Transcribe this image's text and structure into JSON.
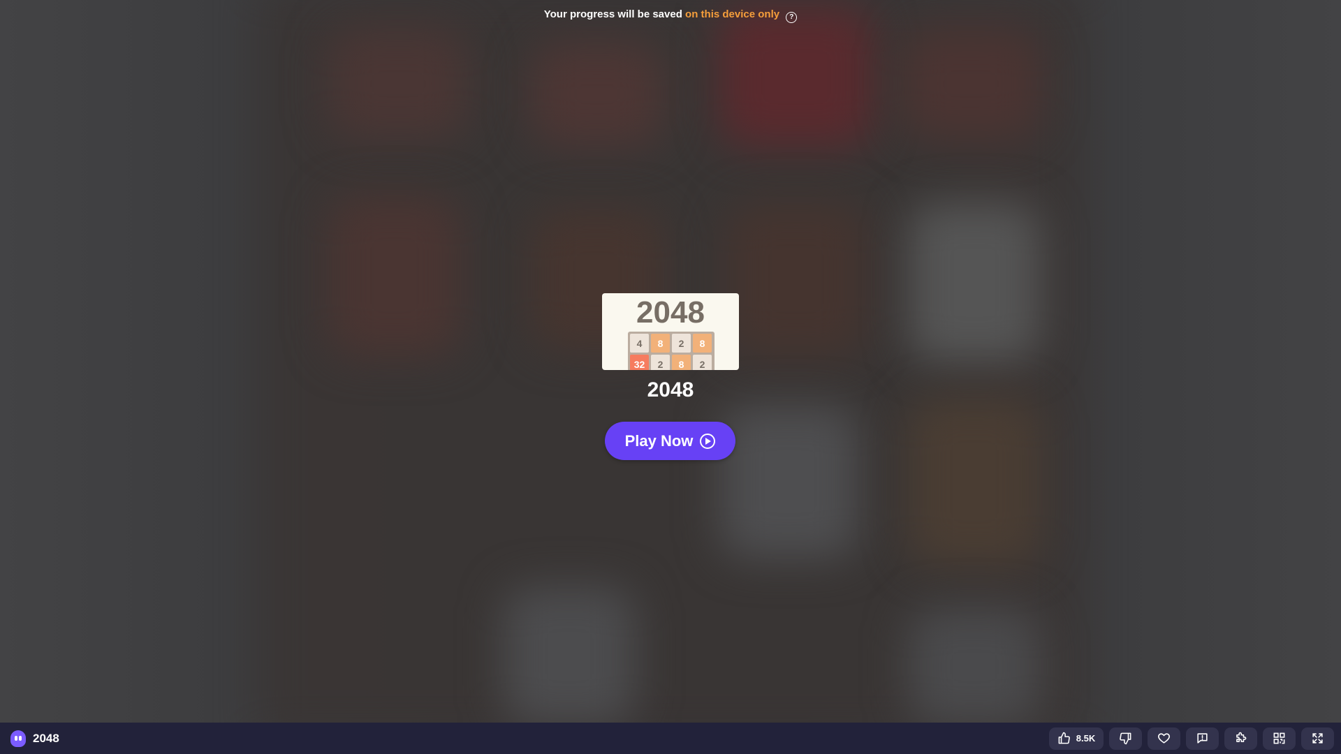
{
  "notice": {
    "prefix": "Your progress will be saved",
    "highlight": "on this device only",
    "help_icon": "?"
  },
  "card": {
    "thumbnail_title": "2048",
    "thumbnail_tiles": [
      {
        "value": "4",
        "bg": "#eee4da",
        "fg": "#776e65"
      },
      {
        "value": "8",
        "bg": "#f2b179",
        "fg": "#ffffff"
      },
      {
        "value": "2",
        "bg": "#eee4da",
        "fg": "#776e65"
      },
      {
        "value": "8",
        "bg": "#f2b179",
        "fg": "#ffffff"
      },
      {
        "value": "32",
        "bg": "#f67c5f",
        "fg": "#ffffff"
      },
      {
        "value": "2",
        "bg": "#eee4da",
        "fg": "#776e65"
      },
      {
        "value": "8",
        "bg": "#f2b179",
        "fg": "#ffffff"
      },
      {
        "value": "2",
        "bg": "#eee4da",
        "fg": "#776e65"
      }
    ],
    "game_title": "2048",
    "play_button_label": "Play Now"
  },
  "bottombar": {
    "app_title": "2048",
    "like_count": "8.5K",
    "icons": [
      "thumbs-up-icon",
      "thumbs-down-icon",
      "heart-icon",
      "report-icon",
      "puzzle-icon",
      "qr-code-icon",
      "fullscreen-icon"
    ]
  },
  "colors": {
    "accent": "#f59e3b",
    "play_button": "#6741f5",
    "bottombar": "#22223a"
  }
}
